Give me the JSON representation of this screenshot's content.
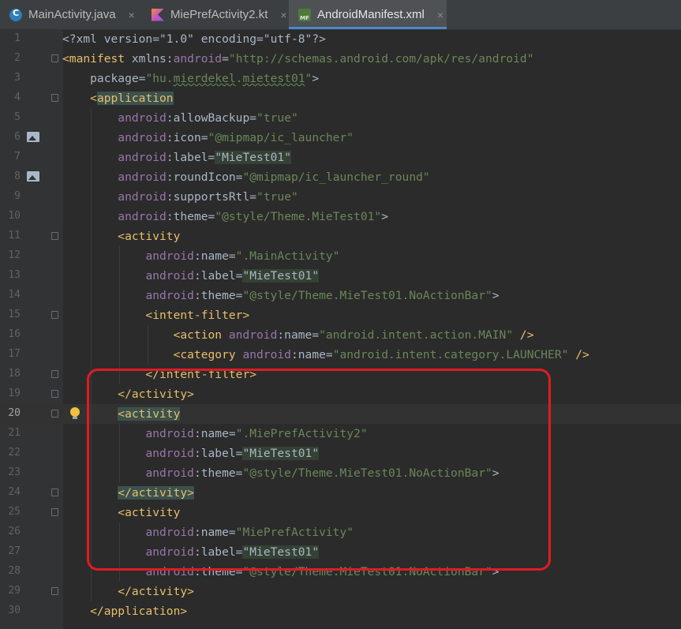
{
  "tabs": [
    {
      "label": "MainActivity.java",
      "icon": "java-class-icon"
    },
    {
      "label": "MiePrefActivity2.kt",
      "icon": "kotlin-file-icon"
    },
    {
      "label": "AndroidManifest.xml",
      "icon": "manifest-file-icon",
      "active": true
    }
  ],
  "close_glyph": "×",
  "current_line": 20,
  "lines": [
    {
      "n": "1",
      "segs": [
        [
          "<?xml version=\"1.0\" encoding=\"utf-8\"?>",
          ""
        ]
      ]
    },
    {
      "n": "2",
      "segs": [
        [
          "<manifest ",
          "t"
        ],
        [
          "xmlns:",
          ""
        ],
        [
          "android",
          "ns"
        ],
        [
          "=",
          ""
        ],
        [
          "\"http://schemas.android.com/apk/res/android\"",
          "v"
        ]
      ]
    },
    {
      "n": "3",
      "segs": [
        [
          "    package=",
          ""
        ],
        [
          "\"hu.",
          "v"
        ],
        [
          "mierdekel",
          "v wavy"
        ],
        [
          ".",
          "v"
        ],
        [
          "mietest01",
          "v wavy"
        ],
        [
          "\"",
          "v"
        ],
        [
          ">",
          ""
        ]
      ]
    },
    {
      "n": "4",
      "segs": [
        [
          "    <",
          "t"
        ],
        [
          "application",
          "t tag-hl"
        ]
      ]
    },
    {
      "n": "5",
      "segs": [
        [
          "        ",
          ""
        ],
        [
          "android",
          "ns"
        ],
        [
          ":allowBackup=",
          ""
        ],
        [
          "\"true\"",
          "v"
        ]
      ]
    },
    {
      "n": "6",
      "segs": [
        [
          "        ",
          ""
        ],
        [
          "android",
          "ns"
        ],
        [
          ":icon=",
          ""
        ],
        [
          "\"@mipmap/ic_launcher\"",
          "v"
        ]
      ]
    },
    {
      "n": "7",
      "segs": [
        [
          "        ",
          ""
        ],
        [
          "android",
          "ns"
        ],
        [
          ":label=",
          ""
        ],
        [
          "\"MieTest01\"",
          "str-hl"
        ]
      ]
    },
    {
      "n": "8",
      "segs": [
        [
          "        ",
          ""
        ],
        [
          "android",
          "ns"
        ],
        [
          ":roundIcon=",
          ""
        ],
        [
          "\"@mipmap/ic_launcher_round\"",
          "v"
        ]
      ]
    },
    {
      "n": "9",
      "segs": [
        [
          "        ",
          ""
        ],
        [
          "android",
          "ns"
        ],
        [
          ":supportsRtl=",
          ""
        ],
        [
          "\"true\"",
          "v"
        ]
      ]
    },
    {
      "n": "10",
      "segs": [
        [
          "        ",
          ""
        ],
        [
          "android",
          "ns"
        ],
        [
          ":theme=",
          ""
        ],
        [
          "\"@style/Theme.MieTest01\"",
          "v"
        ],
        [
          ">",
          ""
        ]
      ]
    },
    {
      "n": "11",
      "segs": [
        [
          "        <activity",
          "t"
        ]
      ]
    },
    {
      "n": "12",
      "segs": [
        [
          "            ",
          ""
        ],
        [
          "android",
          "ns"
        ],
        [
          ":name=",
          ""
        ],
        [
          "\".MainActivity\"",
          "v"
        ]
      ]
    },
    {
      "n": "13",
      "segs": [
        [
          "            ",
          ""
        ],
        [
          "android",
          "ns"
        ],
        [
          ":label=",
          ""
        ],
        [
          "\"MieTest01\"",
          "str-hl"
        ]
      ]
    },
    {
      "n": "14",
      "segs": [
        [
          "            ",
          ""
        ],
        [
          "android",
          "ns"
        ],
        [
          ":theme=",
          ""
        ],
        [
          "\"@style/Theme.MieTest01.NoActionBar\"",
          "v"
        ],
        [
          ">",
          ""
        ]
      ]
    },
    {
      "n": "15",
      "segs": [
        [
          "            <intent-filter>",
          "t"
        ]
      ]
    },
    {
      "n": "16",
      "segs": [
        [
          "                <action ",
          "t"
        ],
        [
          "android",
          "ns"
        ],
        [
          ":name=",
          ""
        ],
        [
          "\"android.intent.action.MAIN\"",
          "v"
        ],
        [
          " />",
          "t"
        ]
      ]
    },
    {
      "n": "17",
      "segs": [
        [
          "                <category ",
          "t"
        ],
        [
          "android",
          "ns"
        ],
        [
          ":name=",
          ""
        ],
        [
          "\"android.intent.category.LAUNCHER\"",
          "v"
        ],
        [
          " />",
          "t"
        ]
      ]
    },
    {
      "n": "18",
      "segs": [
        [
          "            </intent-filter>",
          "t"
        ]
      ]
    },
    {
      "n": "19",
      "segs": [
        [
          "        </activity>",
          "t"
        ]
      ]
    },
    {
      "n": "20",
      "segs": [
        [
          "        ",
          ""
        ],
        [
          "<activity",
          "t tag-hl"
        ]
      ]
    },
    {
      "n": "21",
      "segs": [
        [
          "            ",
          ""
        ],
        [
          "android",
          "ns"
        ],
        [
          ":name=",
          ""
        ],
        [
          "\".MiePrefActivity2\"",
          "v"
        ]
      ]
    },
    {
      "n": "22",
      "segs": [
        [
          "            ",
          ""
        ],
        [
          "android",
          "ns"
        ],
        [
          ":label=",
          ""
        ],
        [
          "\"MieTest01\"",
          "str-hl"
        ]
      ]
    },
    {
      "n": "23",
      "segs": [
        [
          "            ",
          ""
        ],
        [
          "android",
          "ns"
        ],
        [
          ":theme=",
          ""
        ],
        [
          "\"@style/Theme.MieTest01.NoActionBar\"",
          "v"
        ],
        [
          ">",
          ""
        ]
      ]
    },
    {
      "n": "24",
      "segs": [
        [
          "        ",
          ""
        ],
        [
          "</activity>",
          "t tag-hl"
        ]
      ]
    },
    {
      "n": "25",
      "segs": [
        [
          "        <activity",
          "t"
        ]
      ]
    },
    {
      "n": "26",
      "segs": [
        [
          "            ",
          ""
        ],
        [
          "android",
          "ns"
        ],
        [
          ":name=",
          ""
        ],
        [
          "\"MiePrefActivity\"",
          "v"
        ]
      ]
    },
    {
      "n": "27",
      "segs": [
        [
          "            ",
          ""
        ],
        [
          "android",
          "ns"
        ],
        [
          ":label=",
          ""
        ],
        [
          "\"MieTest01\"",
          "str-hl"
        ]
      ]
    },
    {
      "n": "28",
      "segs": [
        [
          "            ",
          ""
        ],
        [
          "android",
          "ns"
        ],
        [
          ":theme=",
          ""
        ],
        [
          "\"@style/Theme.MieTest01.NoActionBar\"",
          "v"
        ],
        [
          ">",
          ""
        ]
      ]
    },
    {
      "n": "29",
      "segs": [
        [
          "        </activity>",
          "t"
        ]
      ]
    },
    {
      "n": "30",
      "segs": [
        [
          "    </application>",
          "t"
        ]
      ]
    }
  ],
  "fold_lines": [
    2,
    4,
    11,
    15,
    18,
    19,
    20,
    24,
    25,
    29
  ],
  "image_icon_lines": [
    6,
    8
  ],
  "intention_bulb_line": 20
}
